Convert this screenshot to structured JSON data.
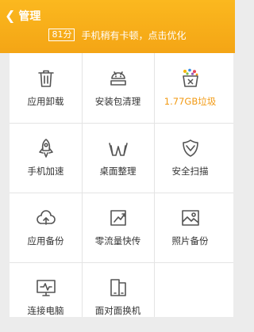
{
  "header": {
    "back_title": "管理",
    "score": "81分",
    "status_text": "手机稍有卡顿，点击优化"
  },
  "tools": [
    {
      "label": "应用卸载",
      "icon": "trash-icon"
    },
    {
      "label": "安装包清理",
      "icon": "android-icon"
    },
    {
      "label": "1.77GB垃圾",
      "icon": "junk-bin-icon",
      "highlight_color": "#f29a13"
    },
    {
      "label": "手机加速",
      "icon": "rocket-icon"
    },
    {
      "label": "桌面整理",
      "icon": "desktop-organize-icon"
    },
    {
      "label": "安全扫描",
      "icon": "shield-icon"
    },
    {
      "label": "应用备份",
      "icon": "cloud-upload-icon"
    },
    {
      "label": "零流量快传",
      "icon": "transfer-icon"
    },
    {
      "label": "照片备份",
      "icon": "photo-icon"
    },
    {
      "label": "连接电脑",
      "icon": "monitor-icon"
    },
    {
      "label": "面对面换机",
      "icon": "phone-switch-icon"
    }
  ]
}
